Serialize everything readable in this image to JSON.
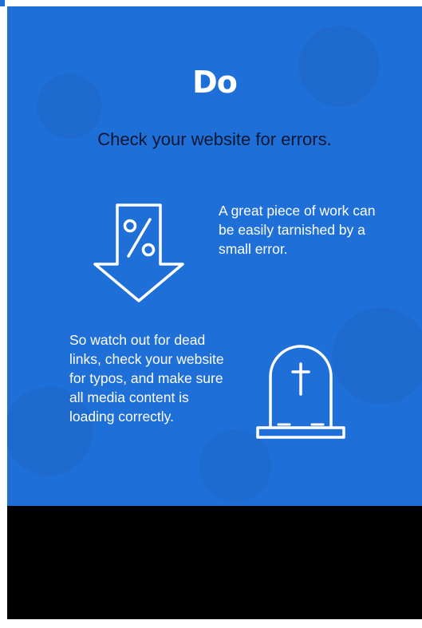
{
  "title": "Do",
  "subtitle": "Check your website for errors.",
  "block1": {
    "icon": "percent-down-arrow-icon",
    "text": "A great piece of work can be easily tarnished by a small error."
  },
  "block2": {
    "icon": "tombstone-icon",
    "text": "So watch out for dead links, check your website for typos, and make sure all media content is loading correctly."
  },
  "colors": {
    "panel": "#1f6fd8",
    "title": "#ffffff",
    "subtitle": "#0b1733",
    "body_text": "#ffffff",
    "below_panel": "#000000"
  }
}
